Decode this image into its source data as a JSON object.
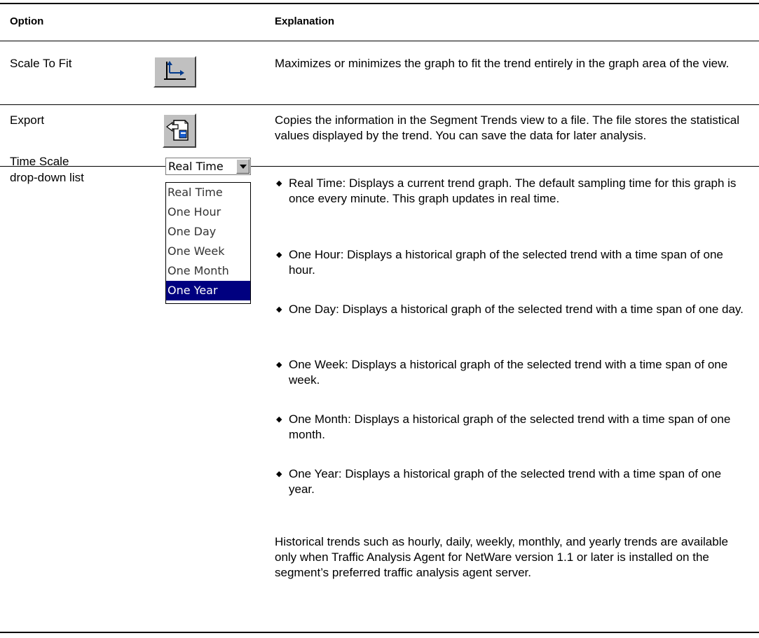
{
  "header": {
    "option": "Option",
    "explanation": "Explanation"
  },
  "rows": [
    {
      "option": "Scale To Fit",
      "icon": "scale-to-fit-icon",
      "explanation": "Maximizes or minimizes the graph to fit the trend entirely in the graph area of the view."
    },
    {
      "option": "Export",
      "icon": "export-icon",
      "explanation": "Copies the information in the Segment Trends view to a file. The file stores the statistical values displayed by the trend. You can save the data for later analysis."
    },
    {
      "option_line1": "Time Scale",
      "option_line2": "drop-down list",
      "dropdown": {
        "selected": "Real Time",
        "options": [
          "Real Time",
          "One Hour",
          "One Day",
          "One Week",
          "One Month",
          "One Year"
        ],
        "highlighted": "One Year"
      },
      "bullets": [
        "Real Time: Displays a current trend graph. The default sampling time for this graph is once every minute. This graph updates in real time.",
        "One Hour: Displays a historical graph of the selected trend with a time span of one hour.",
        "One Day: Displays a historical graph of the selected trend with a time span of one day.",
        "One Week: Displays a historical graph of the selected trend with a time span of one week.",
        "One Month: Displays a historical graph of the selected trend with a time span of one month.",
        "One Year: Displays a historical graph of the selected trend with a time span of one year."
      ],
      "note": "Historical trends such as hourly, daily, weekly, monthly, and yearly trends are available only when Traffic Analysis Agent for NetWare version 1.1 or later is installed on the segment’s preferred traffic analysis agent server."
    }
  ],
  "colors": {
    "highlight": "#000080",
    "button_face": "#c0c0c0"
  }
}
